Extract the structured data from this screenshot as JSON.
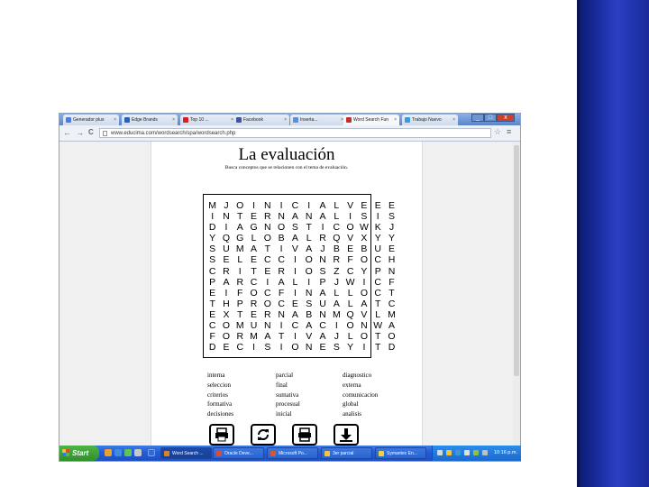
{
  "browser": {
    "tabs": [
      {
        "label": "Generador plus",
        "icon": "google-icon",
        "color": "#4a7be0",
        "active": false
      },
      {
        "label": "Edge Brands",
        "icon": "edge-brands-icon",
        "color": "#2a5fbf",
        "active": false
      },
      {
        "label": "Top 10 ...",
        "icon": "youtube-icon",
        "color": "#d42020",
        "active": false
      },
      {
        "label": "Facebook",
        "icon": "facebook-icon",
        "color": "#3b5998",
        "active": false
      },
      {
        "label": "Inserta...",
        "icon": "page-icon",
        "color": "#5b8fd6",
        "active": false
      },
      {
        "label": "Word Search Fun",
        "icon": "wordsearch-icon",
        "color": "#c03030",
        "active": true
      },
      {
        "label": "Trabajo Nuevo",
        "icon": "page-icon",
        "color": "#3a9adf",
        "active": false
      }
    ],
    "url": "www.educima.com/wordsearch/spa/wordsearch.php",
    "nav": {
      "back": "←",
      "forward": "→",
      "reload": "C"
    },
    "window_buttons": {
      "minimize": "_",
      "maximize": "□",
      "close": "x"
    }
  },
  "worksheet": {
    "title": "La evaluación",
    "subtitle": "Busca conceptos que se relacionen con el tema de evaluación.",
    "grid": [
      "MJOINICIALVEEE",
      "INTERNANALISIS",
      "DIAGNOSTICOWKJ",
      "YQGLOBALRQVXYY",
      "SUMATIVAJBEBUE",
      "SELECCIONRFOCH",
      "CRITERIOSZCYPN",
      "PARCIALIPJWICF",
      "EIFOCFINALLOCT",
      "THPROCESUALATC",
      "EXTERNABNMQVLM",
      "COMUNICACIONWA",
      "FORMATIVAJLOTO",
      "DECISIONESYITD"
    ],
    "words": [
      [
        "interna",
        "seleccion",
        "criterios",
        "formativa",
        "decisiones"
      ],
      [
        "parcial",
        "final",
        "sumativa",
        "procesual",
        "inicial"
      ],
      [
        "diagnostico",
        "externa",
        "comunicacion",
        "global",
        "analisis"
      ]
    ],
    "buttons": [
      "print-icon",
      "refresh-icon",
      "print-solution-icon",
      "download-icon"
    ]
  },
  "taskbar": {
    "start_label": "Start",
    "tasks": [
      {
        "label": "Word Search ...",
        "color": "#d9822b",
        "active": true
      },
      {
        "label": "Oracle Deve...",
        "color": "#e04a3a",
        "active": false
      },
      {
        "label": "Microsoft Po...",
        "color": "#d9582b",
        "active": false
      },
      {
        "label": "3er parcial",
        "color": "#f5c542",
        "active": false
      },
      {
        "label": "Symantec En...",
        "color": "#f2d13b",
        "active": false
      }
    ],
    "clock": "10:16 p.m."
  }
}
